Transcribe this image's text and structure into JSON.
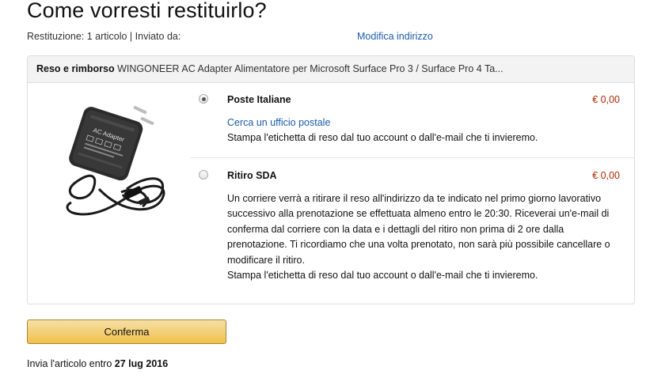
{
  "page": {
    "title": "Come vorresti restituirlo?",
    "summary": "Restituzione: 1 articolo | Inviato da:",
    "modify_address": "Modifica indirizzo"
  },
  "box": {
    "header_bold": "Reso e rimborso",
    "header_product": " WINGONEER AC Adapter Alimentatore per Microsoft Surface Pro 3 / Surface Pro 4 Ta...",
    "image_label": "AC Adapter",
    "options": [
      {
        "name": "Poste Italiane",
        "price": "€ 0,00",
        "selected": true,
        "link": "Cerca un ufficio postale",
        "text": "Stampa l'etichetta di reso dal tuo account o dall'e-mail che ti invieremo."
      },
      {
        "name": "Ritiro SDA",
        "price": "€ 0,00",
        "selected": false,
        "text": "Un corriere verrà a ritirare il reso all'indirizzo da te indicato nel primo giorno lavorativo successivo alla prenotazione se effettuata almeno entro le 20:30. Riceverai un'e-mail di conferma dal corriere con la data e i dettagli del ritiro non prima di 2 ore dalla prenotazione. Ti ricordiamo che una volta prenotato, non sarà più possibile cancellare o modificare il ritiro.",
        "text2": "Stampa l'etichetta di reso dal tuo account o dall'e-mail che ti invieremo."
      }
    ]
  },
  "confirm_label": "Conferma",
  "send_by": {
    "prefix": "Invia l'articolo entro ",
    "date": "27 lug 2016"
  },
  "colors": {
    "link": "#1a5ca8",
    "price": "#b12704",
    "button": "#f0c14b"
  }
}
